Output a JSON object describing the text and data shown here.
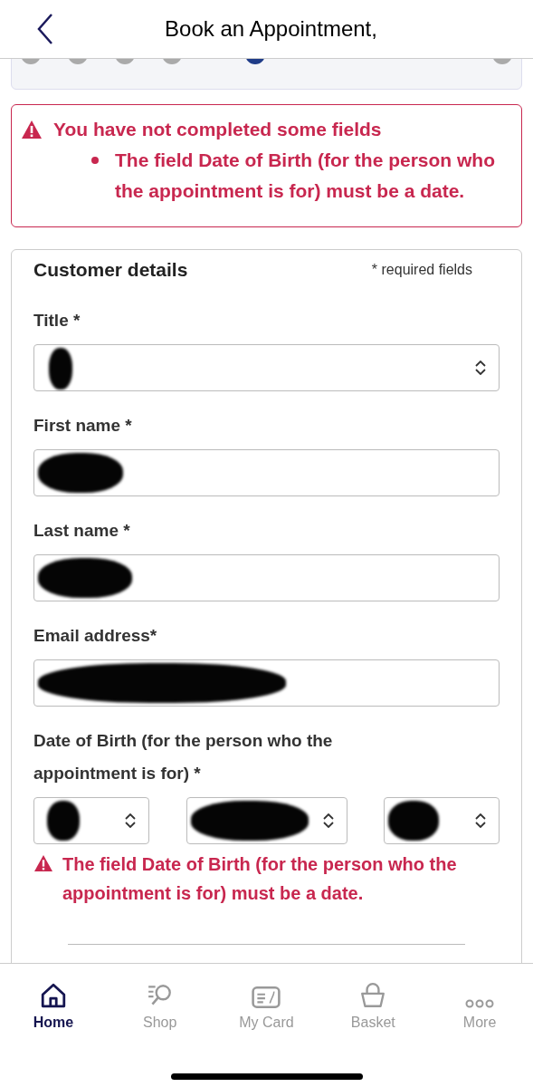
{
  "header": {
    "title": "Book an Appointment,"
  },
  "steps": [
    {
      "selected": false
    },
    {
      "selected": false
    },
    {
      "selected": false
    },
    {
      "selected": false
    },
    {
      "selected": true
    },
    {
      "selected": false
    }
  ],
  "error_summary": {
    "heading": "You have not completed some fields",
    "items": [
      "The field Date of Birth (for the person who the appointment is for) must be a date."
    ]
  },
  "form": {
    "title": "Customer details",
    "required_note": "* required fields",
    "fields": [
      {
        "kind": "select",
        "label": "Title *",
        "redacted": true
      },
      {
        "kind": "text",
        "label": "First name *",
        "redacted": true
      },
      {
        "kind": "text",
        "label": "Last name *",
        "redacted": true
      },
      {
        "kind": "text",
        "label": "Email address*",
        "redacted": true
      },
      {
        "kind": "date",
        "label": "Date of Birth (for the person who the appointment is for) *",
        "redacted": true,
        "error": "The field Date of Birth (for the person who the appointment is for) must be a date."
      }
    ]
  },
  "nav": [
    {
      "label": "Home",
      "selected": true
    },
    {
      "label": "Shop",
      "selected": false
    },
    {
      "label": "My Card",
      "selected": false
    },
    {
      "label": "Basket",
      "selected": false
    },
    {
      "label": "More",
      "selected": false
    }
  ]
}
